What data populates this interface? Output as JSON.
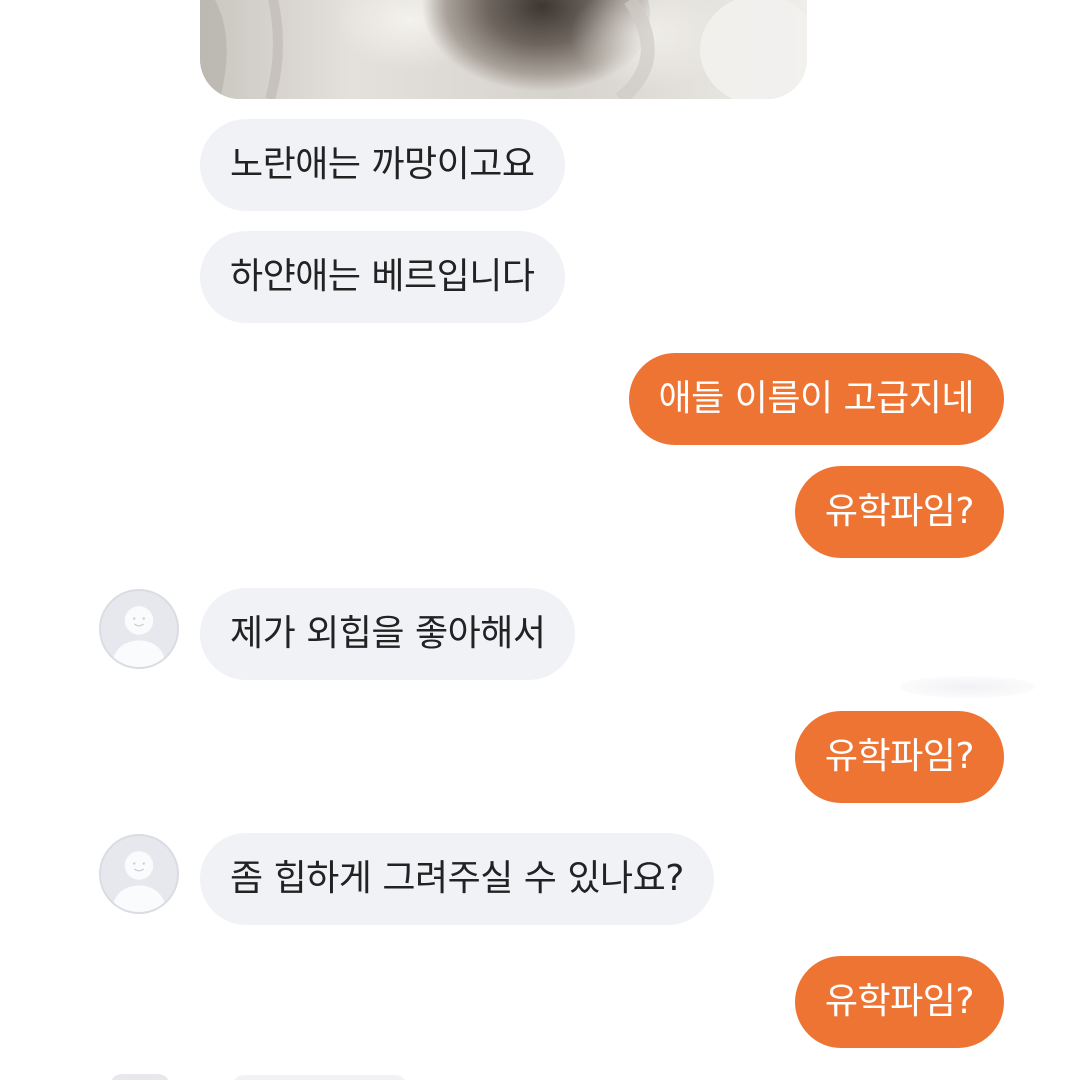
{
  "chat": {
    "photo": {
      "icon": "photo-image"
    },
    "messages": [
      {
        "side": "incoming",
        "text": "노란애는 까망이고요"
      },
      {
        "side": "incoming",
        "text": "하얀애는 베르입니다"
      },
      {
        "side": "outgoing",
        "text": "애들 이름이 고급지네"
      },
      {
        "side": "outgoing",
        "text": "유학파임?"
      },
      {
        "side": "incoming",
        "text": "제가 외힙을 좋아해서"
      },
      {
        "side": "outgoing",
        "text": "유학파임?"
      },
      {
        "side": "incoming",
        "text": "좀 힙하게 그려주실 수 있나요?"
      },
      {
        "side": "outgoing",
        "text": "유학파임?"
      }
    ],
    "avatar_icon": "default-user-avatar-icon"
  },
  "colors": {
    "background": "#ffffff",
    "incoming_bubble": "#f1f2f6",
    "incoming_text": "#222222",
    "outgoing_bubble": "#ee7434",
    "outgoing_text": "#ffffff",
    "avatar_bg": "#e6e8ee"
  }
}
